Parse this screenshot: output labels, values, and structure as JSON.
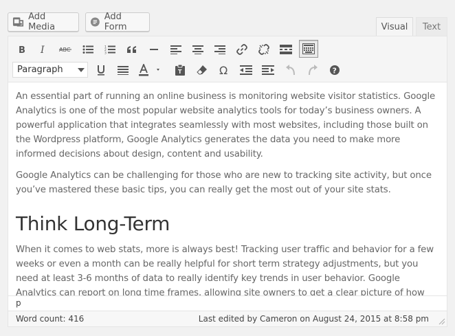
{
  "media_buttons": {
    "add_media": "Add Media",
    "add_form": "Add Form"
  },
  "tabs": {
    "visual": "Visual",
    "text": "Text",
    "active": "visual"
  },
  "toolbar": {
    "row1": [
      "bold-icon",
      "italic-icon",
      "strikethrough-icon",
      "bulleted-list-icon",
      "numbered-list-icon",
      "blockquote-icon",
      "horizontal-line-icon",
      "align-left-icon",
      "align-center-icon",
      "align-right-icon",
      "insert-link-icon",
      "remove-link-icon",
      "read-more-icon",
      "toolbar-toggle-icon"
    ],
    "row2": [
      "underline-icon",
      "justify-icon",
      "text-color-icon",
      "paste-as-text-icon",
      "clear-formatting-icon",
      "special-character-icon",
      "outdent-icon",
      "indent-icon",
      "undo-icon",
      "redo-icon",
      "help-icon"
    ],
    "format_select": "Paragraph"
  },
  "content": {
    "paragraph_1": "An essential part of running an online business is monitoring website visitor statistics. Google Analytics is one of the most popular website analytics tools for today’s business owners.  A powerful application that integrates seamlessly with most websites, including those built on the Wordpress platform, Google Analytics generates the data you need to make more informed decisions about design, content and usability.",
    "paragraph_2": "Google Analytics can be challenging for those who are new to tracking site activity, but once you’ve mastered these basic tips, you can really get the most out of your site stats.",
    "heading_1": "Think Long-Term",
    "paragraph_3": "When it comes to web stats, more is always best!  Tracking user traffic and behavior for a few weeks or even a month can be really helpful for short term strategy adjustments,  but you need at least 3-6 months of data to really identify key trends in user behavior.  Google Analytics can report on long time frames, allowing site owners to get a clear picture of how"
  },
  "path": "p",
  "status": {
    "word_count": "Word count: 416",
    "last_edited": "Last edited by Cameron on August 24, 2015 at 8:58 pm"
  },
  "colors": {
    "background": "#f1f1f1",
    "toolbar": "#f5f5f5",
    "text": "#666666",
    "heading": "#333333"
  }
}
